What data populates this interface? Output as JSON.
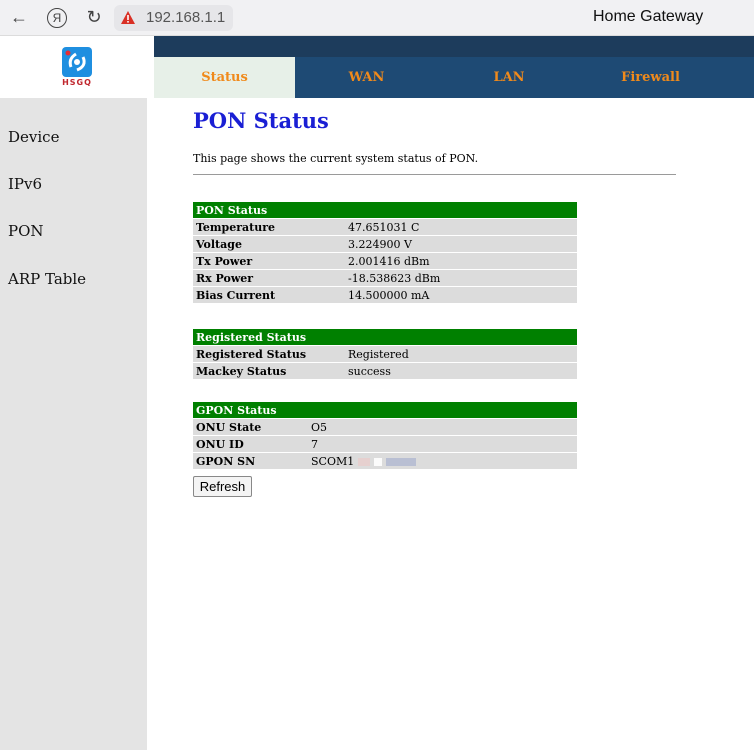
{
  "browser": {
    "address": "192.168.1.1",
    "title": "Home Gateway"
  },
  "logo": {
    "text": "HSGQ"
  },
  "sidebar": {
    "items": [
      {
        "label": "Device"
      },
      {
        "label": "IPv6"
      },
      {
        "label": "PON"
      },
      {
        "label": "ARP Table"
      }
    ]
  },
  "tabs": [
    {
      "label": "Status"
    },
    {
      "label": "WAN"
    },
    {
      "label": "LAN"
    },
    {
      "label": "Firewall"
    }
  ],
  "main": {
    "title": "PON Status",
    "description": "This page shows the current system status of PON.",
    "pon_status": {
      "header": "PON Status",
      "rows": [
        {
          "label": "Temperature",
          "value": "47.651031 C"
        },
        {
          "label": "Voltage",
          "value": "3.224900 V"
        },
        {
          "label": "Tx Power",
          "value": "2.001416 dBm"
        },
        {
          "label": "Rx Power",
          "value": "-18.538623 dBm"
        },
        {
          "label": "Bias Current",
          "value": "14.500000 mA"
        }
      ]
    },
    "registered_status": {
      "header": "Registered Status",
      "rows": [
        {
          "label": "Registered Status",
          "value": "Registered"
        },
        {
          "label": "Mackey Status",
          "value": "success"
        }
      ]
    },
    "gpon_status": {
      "header": "GPON Status",
      "rows": [
        {
          "label": "ONU State",
          "value": "O5"
        },
        {
          "label": "ONU ID",
          "value": "7"
        },
        {
          "label": "GPON SN",
          "value": "SCOM1"
        }
      ]
    },
    "refresh_label": "Refresh"
  }
}
